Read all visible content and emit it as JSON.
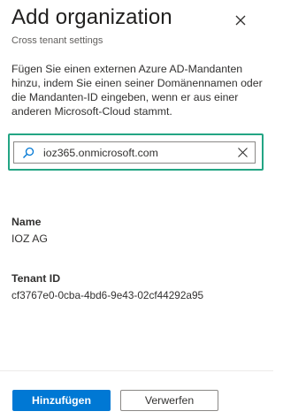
{
  "panel": {
    "title": "Add organization",
    "subtitle": "Cross tenant settings",
    "close_icon": "close-icon",
    "description": "Fügen Sie einen externen Azure AD-Mandanten hinzu, indem Sie einen seiner Domänennamen oder die Mandanten-ID eingeben, wenn er aus einer anderen Microsoft-Cloud stammt."
  },
  "search": {
    "icon": "search-icon",
    "value": "ioz365.onmicrosoft.com",
    "clear_icon": "clear-icon",
    "highlight_color": "#23a584"
  },
  "result": {
    "name_label": "Name",
    "name_value": "IOZ AG",
    "tenant_label": "Tenant ID",
    "tenant_value": "cf3767e0-0cba-4bd6-9e43-02cf44292a95"
  },
  "footer": {
    "primary_label": "Hinzufügen",
    "secondary_label": "Verwerfen",
    "primary_color": "#0078d4"
  }
}
